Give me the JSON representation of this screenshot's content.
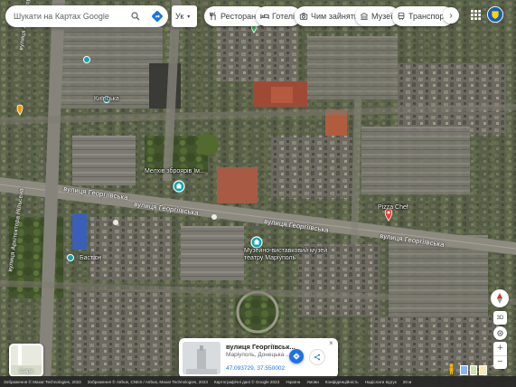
{
  "search": {
    "placeholder": "Шукати на Картах Google"
  },
  "language": {
    "label": "Ук"
  },
  "categories": [
    {
      "label": "Ресторани",
      "icon": "restaurant-icon"
    },
    {
      "label": "Готелі",
      "icon": "hotel-icon"
    },
    {
      "label": "Чим зайнятися",
      "icon": "camera-icon"
    },
    {
      "label": "Музеї",
      "icon": "museum-icon"
    },
    {
      "label": "Транспорт",
      "icon": "transit-icon"
    }
  ],
  "map_labels": {
    "museum": "Мелхів зброярів Ім...",
    "museum2": "Музейно-виставковий музей\nтеатру Маріуполь",
    "street1": "вулиця Георгіївська",
    "street2": "вулиця Георгіївська",
    "street3": "вулиця Георгіївська",
    "street4": "вулиця Георгіївська",
    "vert_street1": "вулиця Архітектора Нільсена",
    "vert_street2": "вулиця Архітектора Нільсена",
    "place_right": "Pizza Chef",
    "small1": "Київська",
    "small2": "Бастіон"
  },
  "layers": {
    "label": "Шари"
  },
  "card": {
    "title": "вулиця Георгіївськ...",
    "subtitle": "Маріуполь, Донецька ...",
    "coords": "47.093729, 37.550002"
  },
  "bottom": {
    "items": [
      "Зображення © Maxar Technologies, 2023",
      "Зображення © Airbus, CNES / Airbus, Maxar Technologies, 2023",
      "Картографічні дані © Google 2023",
      "Україна",
      "Умови",
      "Конфіденційність",
      "Надіслати відгук",
      "20 м"
    ]
  },
  "colors": {
    "accent": "#1a73e8",
    "pin_red": "#ea4335",
    "pin_teal": "#12a4af",
    "pin_orange": "#f29900",
    "pin_green": "#34a853"
  }
}
